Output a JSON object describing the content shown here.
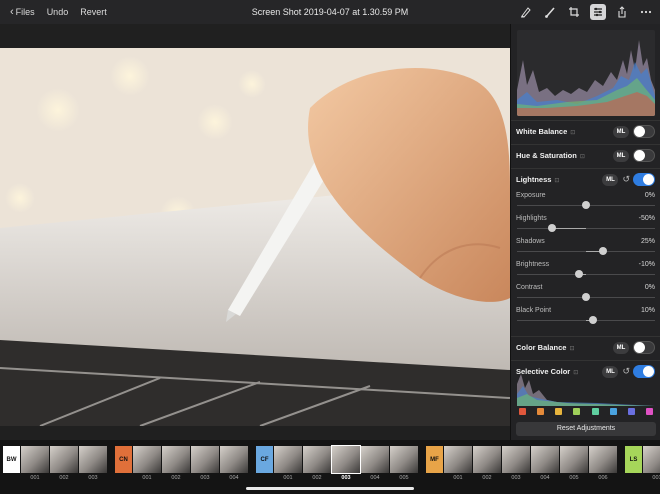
{
  "topbar": {
    "back_label": "Files",
    "undo_label": "Undo",
    "revert_label": "Revert",
    "title": "Screen Shot 2019-04-07 at 1.30.59 PM",
    "icons": [
      "markup-icon",
      "brush-icon",
      "crop-icon",
      "adjustments-icon",
      "share-icon",
      "more-icon"
    ],
    "active_icon": "adjustments-icon"
  },
  "panel": {
    "white_balance": {
      "label": "White Balance",
      "ml": "ML",
      "enabled": false
    },
    "hue_saturation": {
      "label": "Hue & Saturation",
      "ml": "ML",
      "enabled": false
    },
    "lightness": {
      "label": "Lightness",
      "ml": "ML",
      "enabled": true,
      "sliders": [
        {
          "label": "Exposure",
          "value": "0%",
          "level": 0
        },
        {
          "label": "Highlights",
          "value": "-50%",
          "level": -50
        },
        {
          "label": "Shadows",
          "value": "25%",
          "level": 25
        },
        {
          "label": "Brightness",
          "value": "-10%",
          "level": -10
        },
        {
          "label": "Contrast",
          "value": "0%",
          "level": 0
        },
        {
          "label": "Black Point",
          "value": "10%",
          "level": 10
        }
      ]
    },
    "color_balance": {
      "label": "Color Balance",
      "ml": "ML",
      "enabled": false
    },
    "selective_color": {
      "label": "Selective Color",
      "ml": "ML",
      "enabled": true,
      "swatches": [
        "#e0573c",
        "#e58a3a",
        "#e7b43d",
        "#9fd05a",
        "#5fcfa0",
        "#4aa3e0",
        "#6a6fe0",
        "#e052c5"
      ]
    },
    "reset_label": "Reset Adjustments",
    "accent": "#2f7de1"
  },
  "filmstrip": {
    "groups": [
      {
        "code": "BW",
        "color": "#ffffff",
        "thumbs": [
          "001",
          "002",
          "003"
        ]
      },
      {
        "code": "CN",
        "color": "#e0703a",
        "thumbs": [
          "001",
          "002",
          "003",
          "004"
        ]
      },
      {
        "code": "CF",
        "color": "#6aa8e0",
        "thumbs": [
          "001",
          "002",
          "003",
          "004",
          "005"
        ],
        "selected": "003"
      },
      {
        "code": "MF",
        "color": "#e8a448",
        "thumbs": [
          "001",
          "002",
          "003",
          "004",
          "005",
          "006"
        ]
      },
      {
        "code": "LS",
        "color": "#a6d65a",
        "thumbs": [
          "001"
        ]
      }
    ]
  }
}
